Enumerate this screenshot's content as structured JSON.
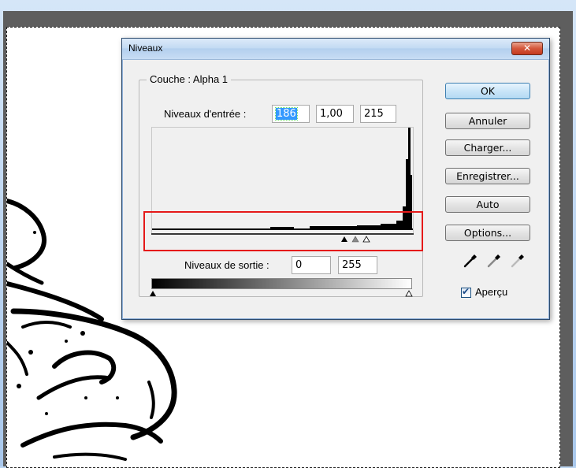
{
  "dialog": {
    "title": "Niveaux",
    "close_glyph": "✕",
    "channel_label": "Couche : Alpha 1",
    "input_levels_label": "Niveaux d'entrée :",
    "input_black": "186",
    "input_gamma": "1,00",
    "input_white": "215",
    "output_levels_label": "Niveaux de sortie :",
    "output_black": "0",
    "output_white": "255",
    "buttons": {
      "ok": "OK",
      "cancel": "Annuler",
      "load": "Charger...",
      "save": "Enregistrer...",
      "auto": "Auto",
      "options": "Options..."
    },
    "preview_label": "Aperçu",
    "preview_checked": true
  },
  "colors": {
    "highlight": "#e51919",
    "selection": "#3399ff"
  },
  "icons": {
    "eyedroppers": [
      "black-eyedropper-icon",
      "gray-eyedropper-icon",
      "white-eyedropper-icon"
    ],
    "input_sliders": [
      "black-point-slider-icon",
      "midtone-slider-icon",
      "white-point-slider-icon"
    ]
  }
}
